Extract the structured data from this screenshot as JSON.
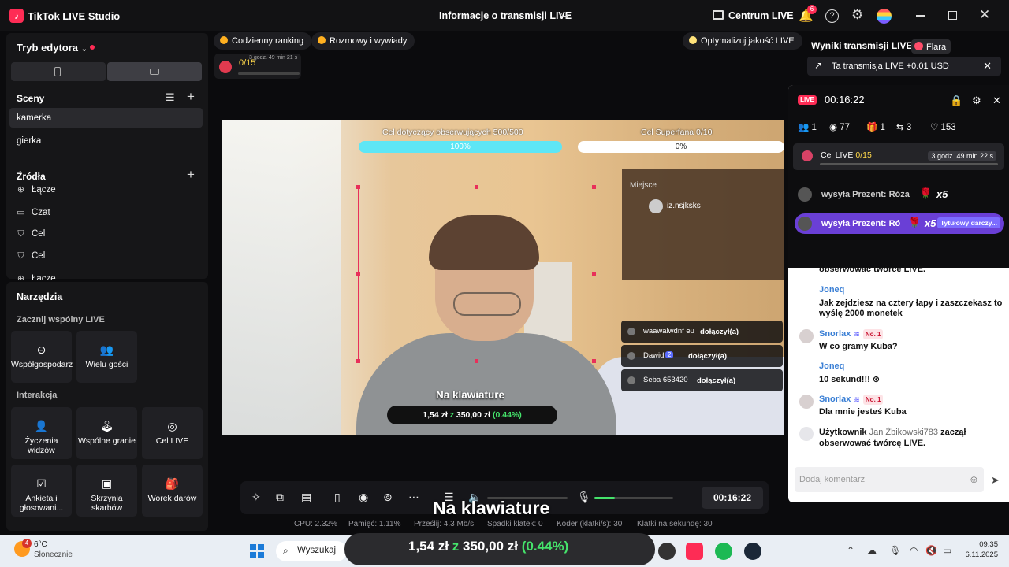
{
  "titlebar": {
    "app_name": "TikTok LIVE Studio",
    "title": "Informacje o transmisji LIVE",
    "center_label": "Centrum LIVE",
    "notif_count": "6"
  },
  "editor": {
    "mode_label": "Tryb edytora",
    "scenes_title": "Sceny",
    "scenes": [
      "kamerka",
      "gierka"
    ],
    "sources_title": "Źródła",
    "sources": [
      "Łącze",
      "Czat",
      "Cel",
      "Cel",
      "Łącze"
    ],
    "tools_title": "Narzędzia",
    "cohost_title": "Zacznij wspólny LIVE",
    "cohost_tools": [
      "Współgospodarz",
      "Wielu gości"
    ],
    "interaction_title": "Interakcja",
    "interaction_tools": [
      "Życzenia widzów",
      "Wspólne granie",
      "Cel LIVE",
      "Ankieta i głosowani...",
      "Skrzynia skarbów",
      "Worek darów"
    ]
  },
  "top_chips": {
    "ranking": "Codzienny ranking",
    "talk": "Rozmowy i wywiady",
    "optimize": "Optymalizuj jakość LIVE"
  },
  "mini_goal": {
    "value": "0/15",
    "time": "3 godz. 49 min 21 s"
  },
  "preview": {
    "goal1_label": "Cel dotyczący obserwujących 500/500",
    "goal1_value": "100%",
    "goal1_progress": 1.0,
    "goal2_label": "Cel Superfana 0/10",
    "goal2_value": "0%",
    "goal2_progress": 0.0,
    "place_label": "Miejsce",
    "place_name": "iz.nsjksks",
    "joins": [
      {
        "name": "waawalwdnf eu",
        "action": "dołączył(a)"
      },
      {
        "name": "Dawid",
        "badge": "2",
        "action": "dołączył(a)"
      },
      {
        "name": "Seba 653420",
        "action": "dołączył(a)"
      }
    ],
    "caption": "Na klawiature",
    "money_amount": "1,54 zł",
    "money_z": "z",
    "money_target": "350,00 zł",
    "money_pct": "(0.44%)"
  },
  "controls": {
    "time": "00:16:22",
    "overlay_caption": "Na klawiature"
  },
  "stats": {
    "cpu": "CPU: 2.32%",
    "memory": "Pamięć: 1.11%",
    "sent": "Prześlij: 4.3 Mb/s",
    "dropped": "Spadki klatek: 0",
    "encoder": "Koder (klatki/s): 30",
    "fps": "Klatki na sekundę: 30"
  },
  "results": {
    "title": "Wyniki transmisji LIVE",
    "flare": "Flara",
    "usd_text": "Ta transmisja LIVE +0.01 USD"
  },
  "live_panel": {
    "badge": "LIVE",
    "time": "00:16:22",
    "stats": {
      "users": "1",
      "viewers": "77",
      "gifts": "1",
      "shares": "3",
      "likes": "153"
    },
    "goal_label": "Cel LIVE",
    "goal_value": "0/15",
    "goal_time": "3 godz. 49 min 22 s",
    "gift1": "wysyła Prezent: Róża",
    "gift1_mult": "x5",
    "gift2": "wysyła Prezent: Ró",
    "gift2_mult": "x5",
    "gift2_tag": "Tytułowy darczy...",
    "partial_line": "obserwować twórcę LIVE.",
    "chat": [
      {
        "user": "Joneq",
        "text": "Jak zejdziesz na cztery łapy i zaszczekasz to wyślę 2000 monetek"
      },
      {
        "user": "Snorlax",
        "badge": "No. 1",
        "text": "W co gramy Kuba?"
      },
      {
        "user": "Joneq",
        "text": "10 sekund!!! ⊛"
      },
      {
        "user": "Snorlax",
        "badge": "No. 1",
        "text": "Dla mnie jesteś Kuba"
      }
    ],
    "follow_prefix": "Użytkownik",
    "follow_name": "Jan Żbikowski783",
    "follow_suffix": "zaczął obserwować twórcę LIVE.",
    "comment_placeholder": "Dodaj komentarz"
  },
  "taskbar": {
    "temp": "6°C",
    "weather": "Słonecznie",
    "weather_badge": "4",
    "search": "Wyszukaj",
    "big_amount": "1,54 zł",
    "big_z": "z",
    "big_target": "350,00 zł",
    "big_pct": "(0.44%)",
    "time": "09:35",
    "date": "6.11.2025"
  }
}
